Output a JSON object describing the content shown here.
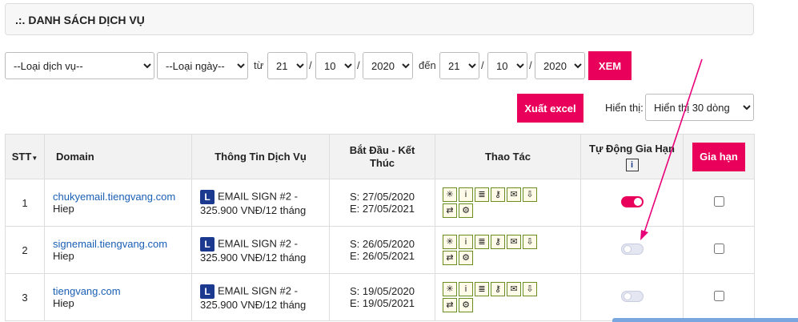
{
  "header": {
    "title": ".:. DANH SÁCH DỊCH VỤ"
  },
  "filters": {
    "service_type": "--Loại dịch vụ--",
    "date_type": "--Loại ngày--",
    "from_label": "từ",
    "from_day": "21",
    "from_month": "10",
    "from_year": "2020",
    "to_label": "đến",
    "to_day": "21",
    "to_month": "10",
    "to_year": "2020",
    "slash": "/",
    "view_button": "XEM"
  },
  "toolbar": {
    "export_button": "Xuất excel",
    "display_label": "Hiển thị:",
    "display_value": "Hiển thị 30 dòng"
  },
  "table": {
    "headers": {
      "stt": "STT",
      "domain": "Domain",
      "info": "Thông Tin Dịch Vụ",
      "dates": "Bắt Đầu - Kết Thúc",
      "actions": "Thao Tác",
      "auto_renew": "Tự Động Gia Hạn",
      "renew_button": "Gia hạn"
    },
    "rows": [
      {
        "stt": "1",
        "domain": "chukyemail.tiengvang.com",
        "owner": "Hiep",
        "service_line1": "EMAIL SIGN #2 -",
        "service_line2": "325.900 VNĐ/12 tháng",
        "start": "S: 27/05/2020",
        "end": "E: 27/05/2021",
        "auto_renew": true
      },
      {
        "stt": "2",
        "domain": "signemail.tiengvang.com",
        "owner": "Hiep",
        "service_line1": "EMAIL SIGN #2 -",
        "service_line2": "325.900 VNĐ/12 tháng",
        "start": "S: 26/05/2020",
        "end": "E: 26/05/2021",
        "auto_renew": false
      },
      {
        "stt": "3",
        "domain": "tiengvang.com",
        "owner": "Hiep",
        "service_line1": "EMAIL SIGN #2 -",
        "service_line2": "325.900 VNĐ/12 tháng",
        "start": "S: 19/05/2020",
        "end": "E: 19/05/2021",
        "auto_renew": false
      }
    ],
    "license_letter": "L",
    "info_letter": "i"
  },
  "colors": {
    "accent": "#e8005a",
    "link": "#1a5fb4",
    "annotation_arrow": "#e8007a"
  }
}
